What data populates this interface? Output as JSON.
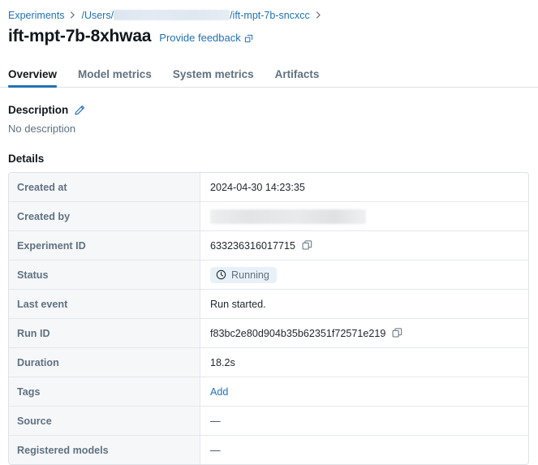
{
  "breadcrumb": {
    "root_label": "Experiments",
    "path_prefix": "/Users/",
    "path_redacted": true,
    "path_suffix": "/ift-mpt-7b-sncxcc",
    "separator_icon": "chevron-right-icon"
  },
  "header": {
    "title": "ift-mpt-7b-8xhwaa",
    "feedback_label": "Provide feedback",
    "feedback_icon": "external-link-icon"
  },
  "tabs": [
    {
      "label": "Overview",
      "active": true
    },
    {
      "label": "Model metrics",
      "active": false
    },
    {
      "label": "System metrics",
      "active": false
    },
    {
      "label": "Artifacts",
      "active": false
    }
  ],
  "description": {
    "heading": "Description",
    "edit_icon": "pencil-icon",
    "body": "No description"
  },
  "details": {
    "heading": "Details",
    "rows": [
      {
        "label": "Created at",
        "value": "2024-04-30 14:23:35",
        "kind": "text"
      },
      {
        "label": "Created by",
        "value": "",
        "kind": "redacted"
      },
      {
        "label": "Experiment ID",
        "value": "633236316017715",
        "kind": "copyable",
        "copy_icon": "copy-icon"
      },
      {
        "label": "Status",
        "value": "Running",
        "kind": "badge",
        "badge_icon": "clock-icon"
      },
      {
        "label": "Last event",
        "value": "Run started.",
        "kind": "text"
      },
      {
        "label": "Run ID",
        "value": "f83bc2e80d904b35b62351f72571e219",
        "kind": "copyable",
        "copy_icon": "copy-icon"
      },
      {
        "label": "Duration",
        "value": "18.2s",
        "kind": "text"
      },
      {
        "label": "Tags",
        "value": "Add",
        "kind": "link"
      },
      {
        "label": "Source",
        "value": "—",
        "kind": "dash"
      },
      {
        "label": "Registered models",
        "value": "—",
        "kind": "dash"
      }
    ]
  },
  "colors": {
    "accent_blue": "#2272b4",
    "label_bg": "#f6f7f9",
    "border": "#dde2e7",
    "badge_bg": "#e9f1f8",
    "muted_text": "#5f7281"
  }
}
